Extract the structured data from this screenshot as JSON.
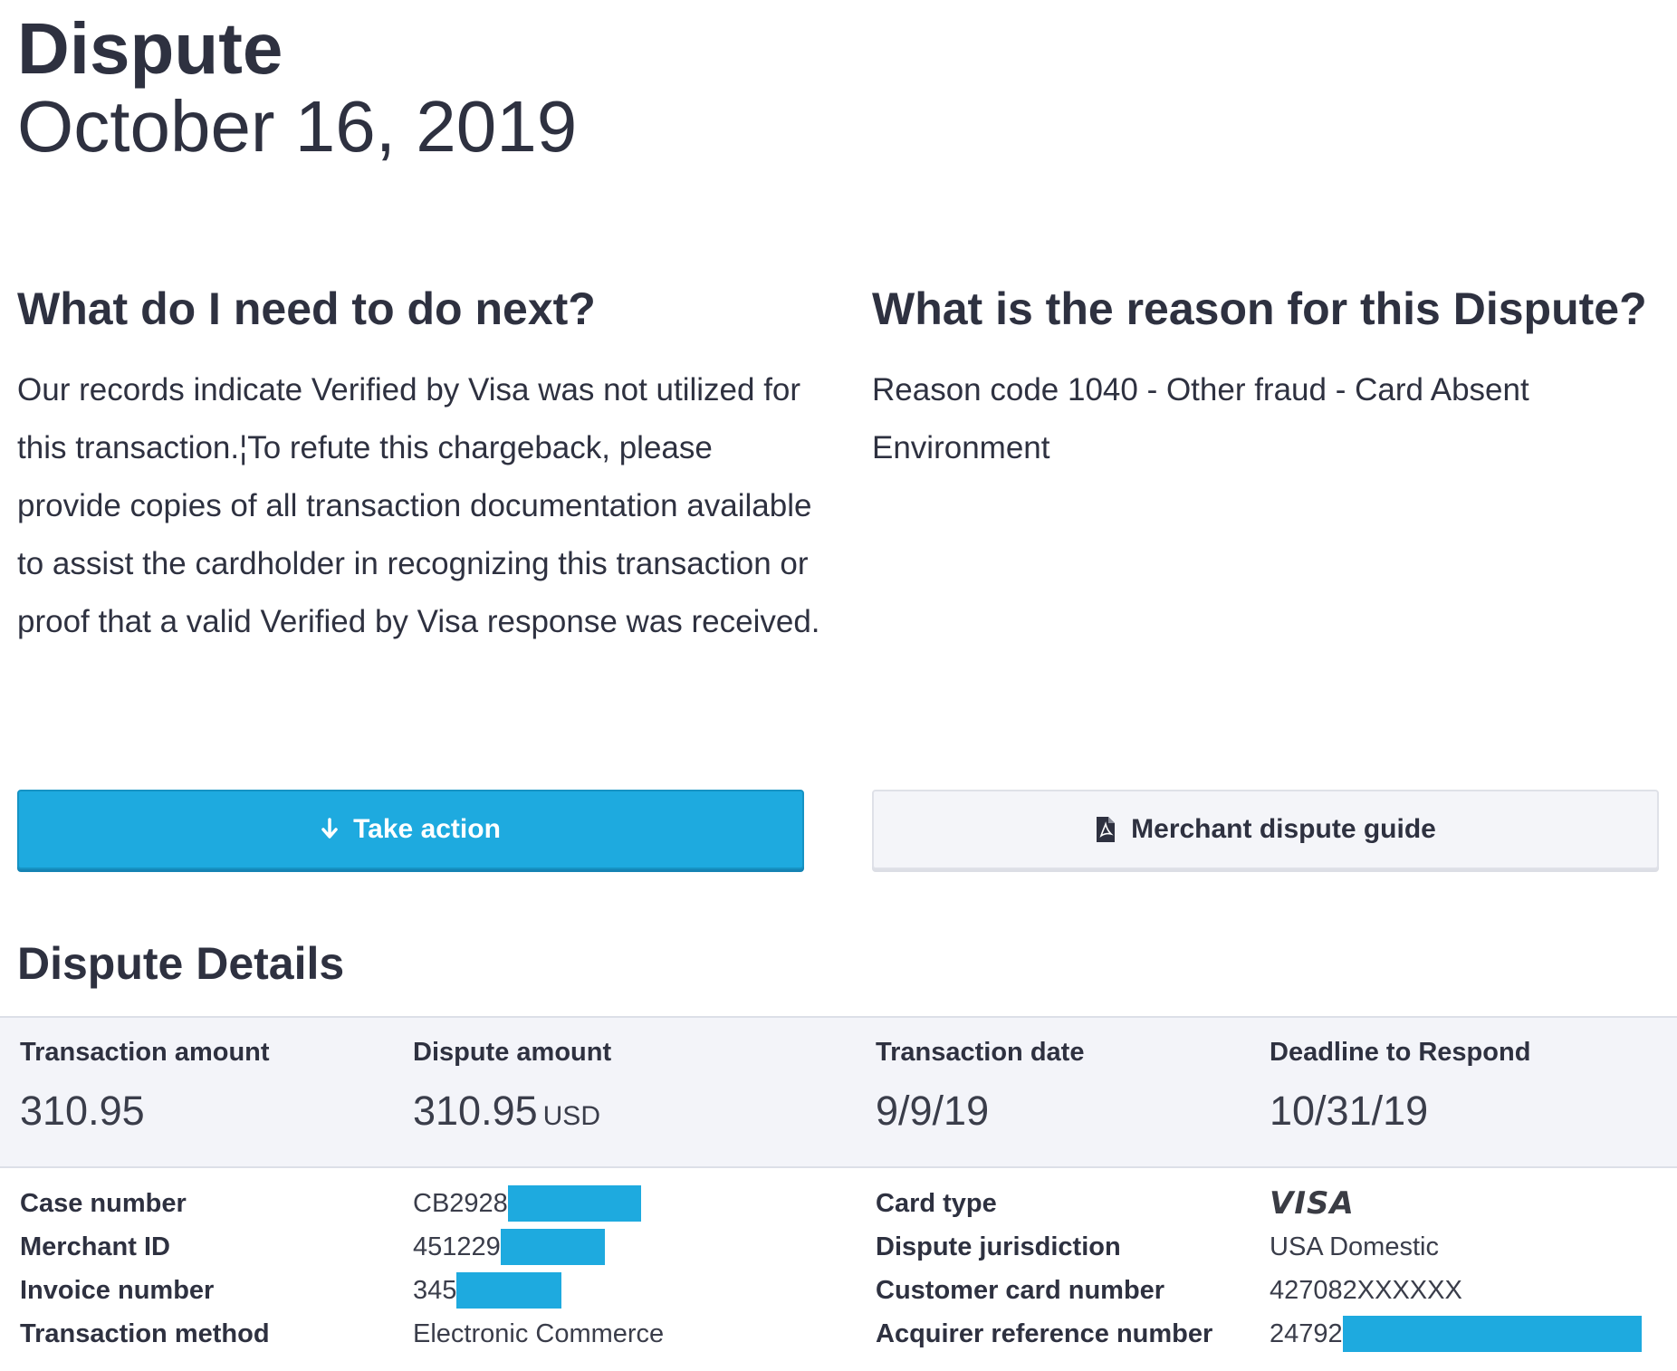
{
  "header": {
    "title": "Dispute",
    "date": "October 16, 2019"
  },
  "next_steps": {
    "heading": "What do I need to do next?",
    "text": "Our records indicate Verified by Visa was not utilized for this transaction.¦To refute this chargeback, please provide copies of all transaction documentation available to assist the cardholder in recognizing this transaction or proof that a valid Verified by Visa response was received."
  },
  "reason": {
    "heading": "What is the reason for this Dispute?",
    "text": "Reason code 1040 - Other fraud - Card Absent Environment"
  },
  "actions": {
    "take_action_label": "Take action",
    "guide_label": "Merchant dispute guide"
  },
  "details": {
    "heading": "Dispute Details",
    "summary": {
      "transaction_amount_label": "Transaction amount",
      "transaction_amount": "310.95",
      "dispute_amount_label": "Dispute amount",
      "dispute_amount": "310.95",
      "dispute_currency": "USD",
      "transaction_date_label": "Transaction date",
      "transaction_date": "9/9/19",
      "deadline_label": "Deadline to Respond",
      "deadline": "10/31/19"
    },
    "case_number_label": "Case number",
    "case_number": "CB2928",
    "merchant_id_label": "Merchant ID",
    "merchant_id": "451229",
    "invoice_number_label": "Invoice number",
    "invoice_number": "345",
    "transaction_method_label": "Transaction method",
    "transaction_method": "Electronic Commerce",
    "card_type_label": "Card type",
    "card_type": "VISA",
    "jurisdiction_label": "Dispute jurisdiction",
    "jurisdiction": "USA Domestic",
    "card_number_label": "Customer card number",
    "card_number": "427082XXXXXX",
    "acquirer_ref_label": "Acquirer reference number",
    "acquirer_ref": "24792"
  },
  "icons": {
    "take_action": "arrow-down-icon",
    "guide": "pdf-document-icon"
  },
  "colors": {
    "primary": "#1eaadf",
    "text": "#2e3140",
    "summary_bg": "#f3f4f9"
  }
}
